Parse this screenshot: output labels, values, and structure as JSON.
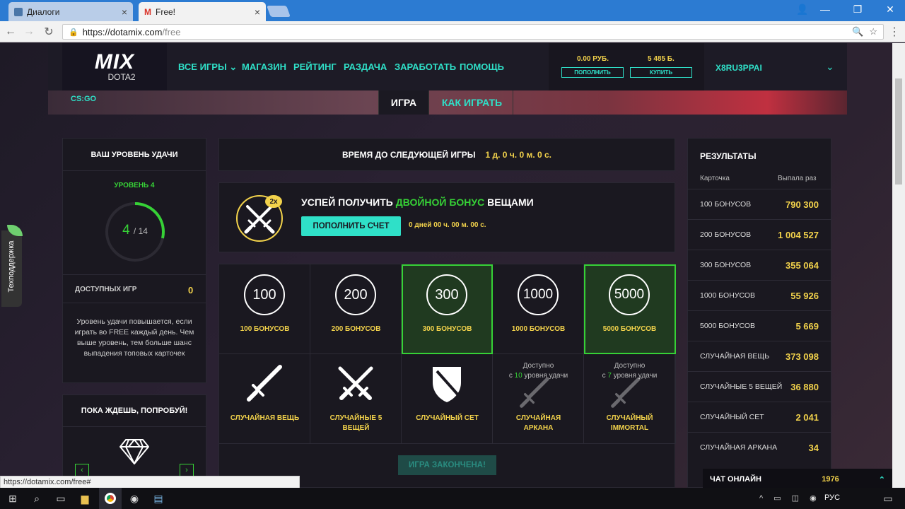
{
  "browser": {
    "tabs": [
      {
        "title": "Диалоги"
      },
      {
        "title": "Free!"
      }
    ],
    "url_host": "https://dotamix.com",
    "url_path": "/free",
    "status_url": "https://dotamix.com/free#"
  },
  "logo": {
    "main": "MIX",
    "sub": "DOTA2"
  },
  "menu": [
    "ВСЕ ИГРЫ",
    "МАГАЗИН",
    "РЕЙТИНГ",
    "РАЗДАЧА",
    "ЗАРАБОТАТЬ",
    "ПОМОЩЬ"
  ],
  "account": {
    "balance": "0.00 РУБ.",
    "bonus": "5 485 Б.",
    "topup_label": "ПОПОЛНИТЬ",
    "buy_label": "КУПИТЬ",
    "username": "X8RU3PPAI"
  },
  "subnav": {
    "csgo": "CS:GO",
    "game_tab": "ИГРА",
    "how_tab": "КАК ИГРАТЬ"
  },
  "support": "Техподдержка",
  "luck": {
    "title": "ВАШ УРОВЕНЬ УДАЧИ",
    "level": "УРОВЕНЬ 4",
    "current": "4",
    "max": "/ 14",
    "progress": 0.2857,
    "available_label": "ДОСТУПНЫХ ИГР",
    "available_value": "0",
    "description": "Уровень удачи повышается, если играть во FREE каждый день. Чем выше уровень, тем больше шанс выпадения топовых карточек"
  },
  "try": {
    "title": "ПОКА ЖДЕШЬ, ПОПРОБУЙ!"
  },
  "timer": {
    "label": "ВРЕМЯ ДО СЛЕДУЮЩЕЙ ИГРЫ",
    "value": "1 д. 0 ч. 0 м. 0 с."
  },
  "bonus": {
    "badge": "2x",
    "title_pre": "УСПЕЙ ПОЛУЧИТЬ",
    "title_hl": "ДВОЙНОЙ БОНУС",
    "title_post": "ВЕЩАМИ",
    "button": "ПОПОЛНИТЬ СЧЕТ",
    "countdown": "0 дней 00 ч. 00 м. 00 с."
  },
  "cards_top": [
    {
      "num": "100",
      "label": "100 БОНУСОВ"
    },
    {
      "num": "200",
      "label": "200 БОНУСОВ"
    },
    {
      "num": "300",
      "label": "300 БОНУСОВ"
    },
    {
      "num": "1000",
      "label": "1000 БОНУСОВ"
    },
    {
      "num": "5000",
      "label": "5000 БОНУСОВ"
    }
  ],
  "cards_bottom": [
    {
      "label": "СЛУЧАЙНАЯ ВЕЩЬ",
      "label2": ""
    },
    {
      "label": "СЛУЧАЙНЫЕ 5",
      "label2": "ВЕЩЕЙ"
    },
    {
      "label": "СЛУЧАЙНЫЙ СЕТ",
      "label2": ""
    },
    {
      "label": "СЛУЧАЙНАЯ",
      "label2": "АРКАНА",
      "avail1": "Доступно",
      "avail_pre": "с ",
      "avail_n": "10",
      "avail_post": " уровня удачи"
    },
    {
      "label": "СЛУЧАЙНЫЙ",
      "label2": "IMMORTAL",
      "avail1": "Доступно",
      "avail_pre": "с ",
      "avail_n": "7",
      "avail_post": " уровня удачи"
    }
  ],
  "game_over": "ИГРА ЗАКОНЧЕНА!",
  "results": {
    "title": "РЕЗУЛЬТАТЫ",
    "col1": "Карточка",
    "col2": "Выпала раз",
    "rows": [
      {
        "name": "100 БОНУСОВ",
        "value": "790 300"
      },
      {
        "name": "200 БОНУСОВ",
        "value": "1 004 527"
      },
      {
        "name": "300 БОНУСОВ",
        "value": "355 064"
      },
      {
        "name": "1000 БОНУСОВ",
        "value": "55 926"
      },
      {
        "name": "5000 БОНУСОВ",
        "value": "5 669"
      },
      {
        "name": "СЛУЧАЙНАЯ ВЕЩЬ",
        "value": "373 098"
      },
      {
        "name": "СЛУЧАЙНЫЕ 5 ВЕЩЕЙ",
        "value": "36 880"
      },
      {
        "name": "СЛУЧАЙНЫЙ СЕТ",
        "value": "2 041"
      },
      {
        "name": "СЛУЧАЙНАЯ АРКАНА",
        "value": "34"
      }
    ]
  },
  "chat": {
    "label": "ЧАТ ОНЛАЙН",
    "count": "1976"
  },
  "taskbar": {
    "lang": "РУС"
  },
  "colors": {
    "accent": "#2fe0c8",
    "green": "#36d136",
    "gold": "#f2d24b"
  }
}
